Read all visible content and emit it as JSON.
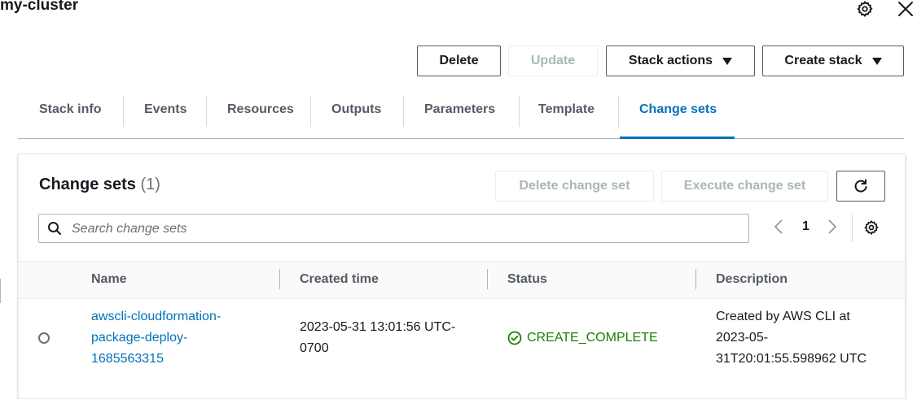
{
  "header": {
    "title": "my-cluster"
  },
  "actions": {
    "delete": "Delete",
    "update": "Update",
    "stack_actions": "Stack actions",
    "create_stack": "Create stack"
  },
  "tabs": [
    {
      "label": "Stack info"
    },
    {
      "label": "Events"
    },
    {
      "label": "Resources"
    },
    {
      "label": "Outputs"
    },
    {
      "label": "Parameters"
    },
    {
      "label": "Template"
    },
    {
      "label": "Change sets",
      "active": true
    }
  ],
  "panel": {
    "title": "Change sets",
    "count": "(1)",
    "delete_change_set": "Delete change set",
    "execute_change_set": "Execute change set",
    "search_placeholder": "Search change sets",
    "page": "1"
  },
  "table": {
    "columns": [
      "Name",
      "Created time",
      "Status",
      "Description"
    ],
    "rows": [
      {
        "name_lines": [
          "awscli-cloudformation-",
          "package-deploy-",
          "1685563315"
        ],
        "created_lines": [
          "2023-05-31 13:01:56 UTC-",
          "0700"
        ],
        "status": "CREATE_COMPLETE",
        "description_lines": [
          "Created by AWS CLI at",
          "2023-05-",
          "31T20:01:55.598962 UTC"
        ]
      }
    ]
  },
  "colors": {
    "accent": "#0073bb",
    "success": "#1d8102",
    "text": "#16191f",
    "muted": "#545b64"
  }
}
